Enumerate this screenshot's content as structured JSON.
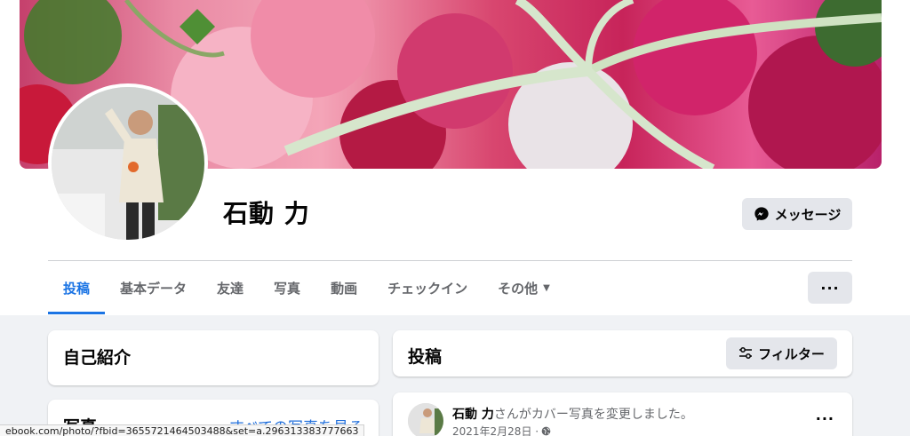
{
  "profile": {
    "name": "石動 力",
    "message_button": "メッセージ",
    "more_button": "···"
  },
  "tabs": [
    {
      "label": "投稿",
      "active": true
    },
    {
      "label": "基本データ"
    },
    {
      "label": "友達"
    },
    {
      "label": "写真"
    },
    {
      "label": "動画"
    },
    {
      "label": "チェックイン"
    },
    {
      "label": "その他"
    }
  ],
  "intro": {
    "title": "自己紹介"
  },
  "photos": {
    "title": "写真",
    "see_all": "すべての写真を見る"
  },
  "posts": {
    "title": "投稿",
    "filter_button": "フィルター",
    "first_post": {
      "author": "石動 力",
      "action": "さんがカバー写真を変更しました。",
      "date": "2021年2月28日 ·",
      "menu": "···"
    }
  },
  "status_bar": {
    "url": "ebook.com/photo/?fbid=3655721464503488&set=a.296313383777663"
  },
  "colors": {
    "accent": "#1b74e4",
    "button_bg": "#e4e6eb",
    "page_bg": "#f0f2f5"
  },
  "icons": {
    "messenger": "messenger-icon",
    "filter": "sliders-icon",
    "caret": "caret-down-icon",
    "privacy": "globe-icon"
  }
}
